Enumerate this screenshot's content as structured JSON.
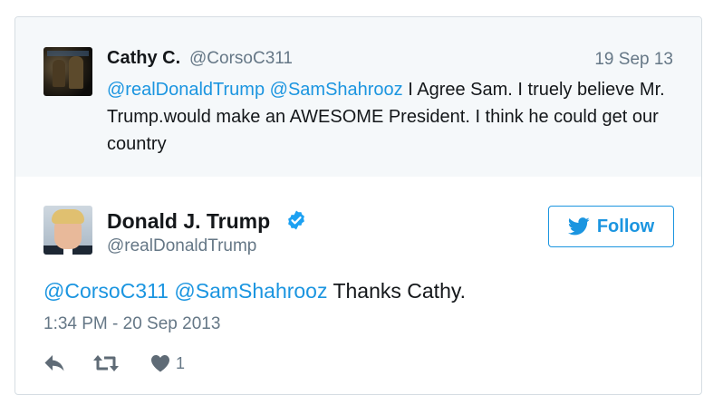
{
  "quoted_tweet": {
    "name": "Cathy C.",
    "handle": "@CorsoC311",
    "date": "19 Sep 13",
    "mention_1": "@realDonaldTrump",
    "mention_2": "@SamShahrooz",
    "text": " I Agree Sam. I truely believe Mr. Trump.would make an AWESOME President. I think he could get our country"
  },
  "main_tweet": {
    "name": "Donald J. Trump",
    "handle": "@realDonaldTrump",
    "follow_label": "Follow",
    "mention_1": "@CorsoC311",
    "mention_2": "@SamShahrooz",
    "text": " Thanks Cathy.",
    "timestamp": "1:34 PM - 20 Sep 2013",
    "like_count": "1"
  },
  "colors": {
    "link": "#1b95e0",
    "muted": "#657786",
    "quoted_bg": "#f5f8fa",
    "action_icon": "#5f6b76"
  },
  "icons": {
    "reply": "reply-icon",
    "retweet": "retweet-icon",
    "like": "heart-icon",
    "verified": "verified-badge-icon",
    "bird": "twitter-bird-icon"
  }
}
